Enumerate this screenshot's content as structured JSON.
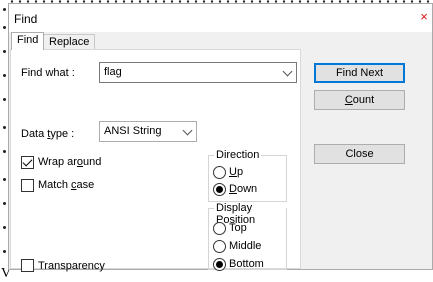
{
  "dialog": {
    "title": "Find",
    "close_glyph": "×"
  },
  "tabs": [
    {
      "label": "Find",
      "active": true
    },
    {
      "label": "Replace",
      "active": false
    }
  ],
  "find_what": {
    "label": "Find what :",
    "value": "flag"
  },
  "data_type": {
    "label_pre": "Data ",
    "label_ul": "t",
    "label_post": "ype :",
    "value": "ANSI String"
  },
  "buttons": {
    "find_next": "Find Next",
    "count_ul": "C",
    "count_rest": "ount",
    "close": "Close"
  },
  "options": {
    "wrap_pre": "Wrap ar",
    "wrap_ul": "o",
    "wrap_post": "und",
    "wrap_checked": true,
    "match_pre": "Match ",
    "match_ul": "c",
    "match_post": "ase",
    "match_checked": false,
    "transparency": "Transparency",
    "transparency_checked": false
  },
  "direction": {
    "title": "Direction",
    "up_ul": "U",
    "up_rest": "p",
    "down_ul": "D",
    "down_rest": "own",
    "selected": "Down"
  },
  "display_position": {
    "title": "Display Position",
    "top": "Top",
    "middle": "Middle",
    "bottom": "Bottom",
    "selected": "Bottom"
  },
  "background": {
    "stray_char": "V"
  },
  "colors": {
    "accent": "#0078d7",
    "close": "#dd1111",
    "dialog_bg": "#f0f0f0"
  }
}
